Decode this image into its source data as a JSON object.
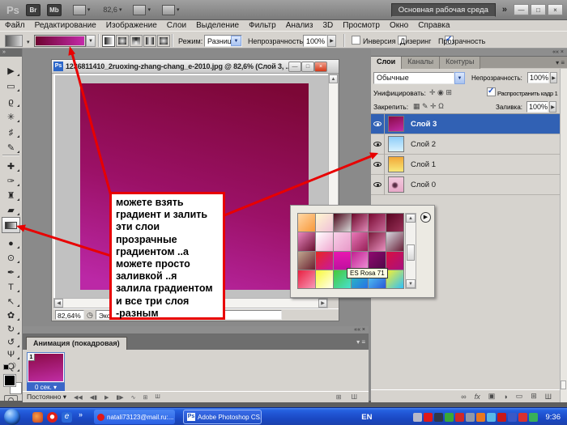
{
  "app": {
    "logo": "Ps",
    "bridge": "Br",
    "minibridge": "Mb",
    "zoom": "82,6",
    "workspace_button": "Основная рабочая среда",
    "chevrons": "»",
    "window_buttons": [
      "—",
      "□",
      "×"
    ]
  },
  "menu": {
    "items": [
      "Файл",
      "Редактирование",
      "Изображение",
      "Слои",
      "Выделение",
      "Фильтр",
      "Анализ",
      "3D",
      "Просмотр",
      "Окно",
      "Справка"
    ]
  },
  "options_bar": {
    "gradient_preview": "linear-gradient(90deg,#6e0430,#c42aaa)",
    "gradient_types": [
      "linear-gradient(90deg,#222,#eee)",
      "radial-gradient(circle,#eee,#222)",
      "conic-gradient(#222,#eee,#222)",
      "linear-gradient(90deg,#222,#eee,#222)",
      "radial-gradient(#eee,#222)"
    ],
    "mode_label": "Режим:",
    "mode_value": "Разница",
    "opacity_label": "Непрозрачность:",
    "opacity_value": "100%",
    "checkboxes": [
      {
        "label": "Инверсия",
        "checked": false
      },
      {
        "label": "Дизеринг",
        "checked": false
      },
      {
        "label": "Прозрачность",
        "checked": true
      }
    ]
  },
  "toolbar": {
    "tools": [
      {
        "name": "move-tool",
        "glyph": "▶"
      },
      {
        "name": "marquee-tool",
        "glyph": "▭"
      },
      {
        "name": "lasso-tool",
        "glyph": "ϱ"
      },
      {
        "name": "quick-selection-tool",
        "glyph": "✳"
      },
      {
        "name": "crop-tool",
        "glyph": "♯"
      },
      {
        "name": "eyedropper-tool",
        "glyph": "✎"
      },
      {
        "name": "healing-brush-tool",
        "glyph": "✚"
      },
      {
        "name": "brush-tool",
        "glyph": "✑"
      },
      {
        "name": "clone-stamp-tool",
        "glyph": "♜"
      },
      {
        "name": "eraser-tool",
        "glyph": "▰"
      },
      {
        "name": "gradient-tool",
        "glyph": "",
        "selected": true
      },
      {
        "name": "blur-tool",
        "glyph": "●"
      },
      {
        "name": "dodge-tool",
        "glyph": "⊙"
      },
      {
        "name": "pen-tool",
        "glyph": "✒"
      },
      {
        "name": "type-tool",
        "glyph": "T"
      },
      {
        "name": "path-selection-tool",
        "glyph": "↖"
      },
      {
        "name": "custom-shape-tool",
        "glyph": "✿"
      },
      {
        "name": "3d-rotate-tool",
        "glyph": "↻"
      },
      {
        "name": "3d-orbit-tool",
        "glyph": "↺"
      },
      {
        "name": "hand-tool",
        "glyph": "Ψ"
      },
      {
        "name": "zoom-tool",
        "glyph": "Q"
      }
    ],
    "foreground_color": "#000000",
    "background_color": "#ffffff"
  },
  "document": {
    "title": "1236811410_2ruoxing-zhang-chang_e-2010.jpg @ 82,6% (Слой 3, ...",
    "zoom": "82,64%",
    "status": "Экспоз",
    "image_gradient": "linear-gradient(195deg,#7c0736 5%,#9c1168 55%,#bb28a6 95%)"
  },
  "annotation": {
    "border_color": "#e80000",
    "lines": [
      "можете взять",
      "градиент и залить",
      "эти слои",
      "прозрачные",
      "градиентом ..а",
      "можете просто",
      "заливкой ..я",
      "залила градиентом",
      "и все три слоя",
      "-разным"
    ]
  },
  "layers_panel": {
    "collapse_icon": "««",
    "close_icon": "×",
    "tabs": [
      {
        "label": "Слои",
        "active": true
      },
      {
        "label": "Каналы",
        "active": false
      },
      {
        "label": "Контуры",
        "active": false
      }
    ],
    "blend_mode": "Обычные",
    "opacity_label": "Непрозрачность:",
    "opacity_value": "100%",
    "unify_label": "Унифицировать:",
    "propagate_label": "Распространить кадр 1",
    "propagate_checked": true,
    "lock_label": "Закрепить:",
    "fill_label": "Заливка:",
    "fill_value": "100%",
    "layers": [
      {
        "name": "Слой 3",
        "selected": true,
        "thumb": "linear-gradient(160deg,#8a0a45,#c12da8)"
      },
      {
        "name": "Слой 2",
        "selected": false,
        "thumb": "linear-gradient(180deg,#8ecdf8,#d8f2ff)"
      },
      {
        "name": "Слой 1",
        "selected": false,
        "thumb": "linear-gradient(180deg,#f2a838,#f8e878)"
      },
      {
        "name": "Слой 0",
        "selected": false,
        "thumb": "radial-gradient(circle at 42% 55%,#4a2840 0%,#6a3850 16%,rgba(0,0,0,0) 30%),linear-gradient(180deg,#f2cade,#e8a8c8)"
      }
    ]
  },
  "gradient_picker": {
    "tooltip": "ES Rosa 71",
    "swatches": [
      "linear-gradient(135deg,#ffd8a8,#f89838)",
      "linear-gradient(135deg,#fff8d0,#f0c0d8)",
      "linear-gradient(135deg,#4a0418,#d8d8d8)",
      "linear-gradient(135deg,#6a0828,#e088b8)",
      "linear-gradient(135deg,#780830,#c86898)",
      "linear-gradient(135deg,#580420,#983058)",
      "linear-gradient(135deg,#e888c0,#6a1030)",
      "linear-gradient(135deg,#ffffff,#f0a8d0)",
      "linear-gradient(135deg,#f8d0e8,#e898c8)",
      "linear-gradient(135deg,#e878b8,#982058)",
      "linear-gradient(135deg,#781838,#e890c0)",
      "linear-gradient(135deg,#d8d8e0,#682038)",
      "linear-gradient(135deg,#c0a890,#6a2030)",
      "linear-gradient(135deg,#e82820,#c818a0)",
      "linear-gradient(180deg,#e818b0,#c010a0)",
      "linear-gradient(135deg,#c02090,#f090d8)",
      "linear-gradient(135deg,#900870,#500848)",
      "linear-gradient(135deg,#d81040,#a81080)",
      "linear-gradient(135deg,#e82040,#f898b8)",
      "linear-gradient(135deg,#f8f838,#fffff0)",
      "linear-gradient(135deg,#48c838,#48e0d0)",
      "linear-gradient(135deg,#28c8b8,#2870e8)",
      "linear-gradient(135deg,#58d8f8,#2858d8)",
      "linear-gradient(135deg,#f8f030,#30c0f8)"
    ]
  },
  "animation_panel": {
    "tab": "Анимация (покадровая)",
    "frame_number": "1",
    "frame_time": "0 сек.",
    "loop_value": "Постоянно",
    "playback": [
      "◀◀",
      "◀▮",
      "▶",
      "▮▶"
    ],
    "frame_thumb": "linear-gradient(170deg,#8a0a45,#c02da5)"
  },
  "taskbar": {
    "tasks": [
      {
        "label": "natali73123@mail.ru:...",
        "active": false
      },
      {
        "label": "Adobe Photoshop CS...",
        "active": true
      }
    ],
    "language": "EN",
    "time": "9:36",
    "tray_colors": [
      "#b8b8c8",
      "#e01818",
      "#303848",
      "#38a838",
      "#d02828",
      "#9098a8",
      "#e87820",
      "#58b8e8",
      "#c81818",
      "#3858c8",
      "#d83030",
      "#38b058"
    ]
  }
}
